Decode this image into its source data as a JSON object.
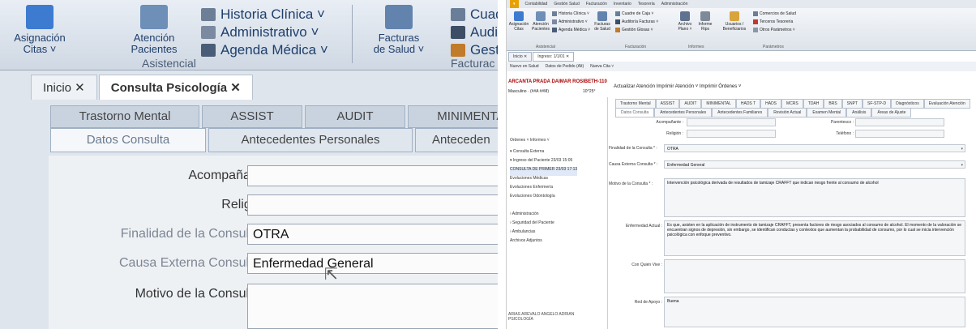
{
  "left": {
    "ribbon": {
      "assign_label": "Asignación\nCitas ˅",
      "attend_label": "Atención\nPacientes",
      "historia": "Historia Clínica ˅",
      "administrativo": "Administrativo ˅",
      "agenda": "Agenda Médica ˅",
      "asistencial_group": "Asistencial",
      "facturas_label": "Facturas\nde Salud ˅",
      "cuad_label": "Cuad",
      "audi_label": "Audi",
      "gest_label": "Gest",
      "factura_group": "Facturac"
    },
    "doc_tabs": [
      "Inicio ✕",
      "Consulta Psicología ✕"
    ],
    "tabs_row1": [
      "Trastorno Mental",
      "ASSIST",
      "AUDIT",
      "MINIMENTAL"
    ],
    "tabs_row2": [
      "Datos Consulta",
      "Antecedentes Personales",
      "Anteceden"
    ],
    "form": {
      "acompanante": "Acompañante :",
      "religion": "Religión :",
      "finalidad": "Finalidad de la Consulta * :",
      "finalidad_value": "OTRA",
      "causa": "Causa Externa Consulta * :",
      "causa_value": "Enfermedad General",
      "motivo": "Motivo de la Consulta * :"
    }
  },
  "right": {
    "menu": [
      "Contabilidad",
      "Gestión Salud",
      "Facturación",
      "Inventario",
      "Tesorería",
      "Administración"
    ],
    "ribbon": {
      "asignacion": "Asignación\nCitas",
      "atencion": "Atención\nPacientes",
      "historia": "Historia Clínica ˅",
      "administrativo": "Administrativo ˅",
      "agenda": "Agenda Médica ˅",
      "asistencial": "Asistencial",
      "facturas": "Facturas\nde Salud",
      "cuadre": "Cuadre de Caja ˅",
      "auditoria": "Auditoría Facturas ˅",
      "gestion": "Gestión Glosas ˅",
      "facturacion": "Facturación",
      "archivo": "Archivo\nPlano ˅",
      "informe": "Informe\nRips",
      "informes_grp": "Informes",
      "usuarios": "Usuarios /\nBeneficiarios",
      "comercios": "Comercios de Salud",
      "terceros": "Terceros Tesorería",
      "otros": "Otros Parámetros ˅",
      "parametros_grp": "Parámetros"
    },
    "doc_tabs": [
      "Inicio ✕",
      "Ingreso: 1/1/01 ✕"
    ],
    "toolbar": [
      "Nuevo en Salud",
      "Datos de Pedido (Alt)",
      "Nueva Cita ˅"
    ],
    "patient_name": "ARCANTA PRADA DAIMAR ROSIBETH-110",
    "patient_sex": "Masculino · (##A ##M)",
    "patient_age": "10^25°",
    "side_buttons": "Ordenes ˅  Informes ˅",
    "tree": [
      "▾ Consulta Externa",
      "   ▾ Ingreso del Paciente       23/03 15:05",
      "        CONSULTA DE PRIMER   23/03 17:13",
      "   Evoluciones Médicas",
      "   Evoluciones Enfermería",
      "   Evoluciones Odontología",
      "",
      "› Administración",
      "› Seguridad del Paciente",
      "› Ambulancias",
      "  Archivos Adjuntos"
    ],
    "footer": "ARIAS AREVALO ANGELO ADRIAN\nPSICOLOGÍA",
    "actions": "Actualizar Atención   Imprimir Atención ˅   Imprimir Órdenes ˅",
    "tabs_row1": [
      "Trastorno Mental",
      "ASSIST",
      "AUDIT",
      "MINIMENTAL",
      "HADS T",
      "HADS",
      "MCRS",
      "TDAH",
      "BRS",
      "SNPT",
      "SF-STP-D",
      "Diagnósticos",
      "Evaluación Atención"
    ],
    "tabs_row2": [
      "Datos Consulta",
      "Antecedentes Personales",
      "Antecedentes Familiares",
      "Revisión Actual",
      "Examen Mental",
      "Análisis",
      "Áreas de Ajuste"
    ],
    "form": {
      "acompanante": "Acompañante :",
      "parentesco": "Parentesco :",
      "religion": "Religión :",
      "telefono": "Teléfono :",
      "finalidad": "Finalidad de la Consulta * :",
      "finalidad_value": "OTRA",
      "causa": "Causa Externa Consulta * :",
      "causa_value": "Enfermedad General",
      "motivo": "Motivo de la Consulta * :",
      "motivo_value": "Intervención psicológica derivada de resultados de tamizaje CRAFFT que indican riesgo frente al consumo de alcohol",
      "enfermedad": "Enfermedad Actual :",
      "enfermedad_value": "Es que, asisten en la aplicación de instrumento de tamizaje CRAFFT, presenta factores de riesgo asociados al consumo de alcohol. El momento de la valoración se encuentran signos de depresión, sin embargo, se identifican conductas y contextos que aumentan la probabilidad de consumo, por lo cual se inicia intervención psicológica con enfoque preventivo.",
      "con_quien": "Con Quién Vive :",
      "red_apoyo": "Red de Apoyo :",
      "red_apoyo_value": "Buena"
    }
  }
}
